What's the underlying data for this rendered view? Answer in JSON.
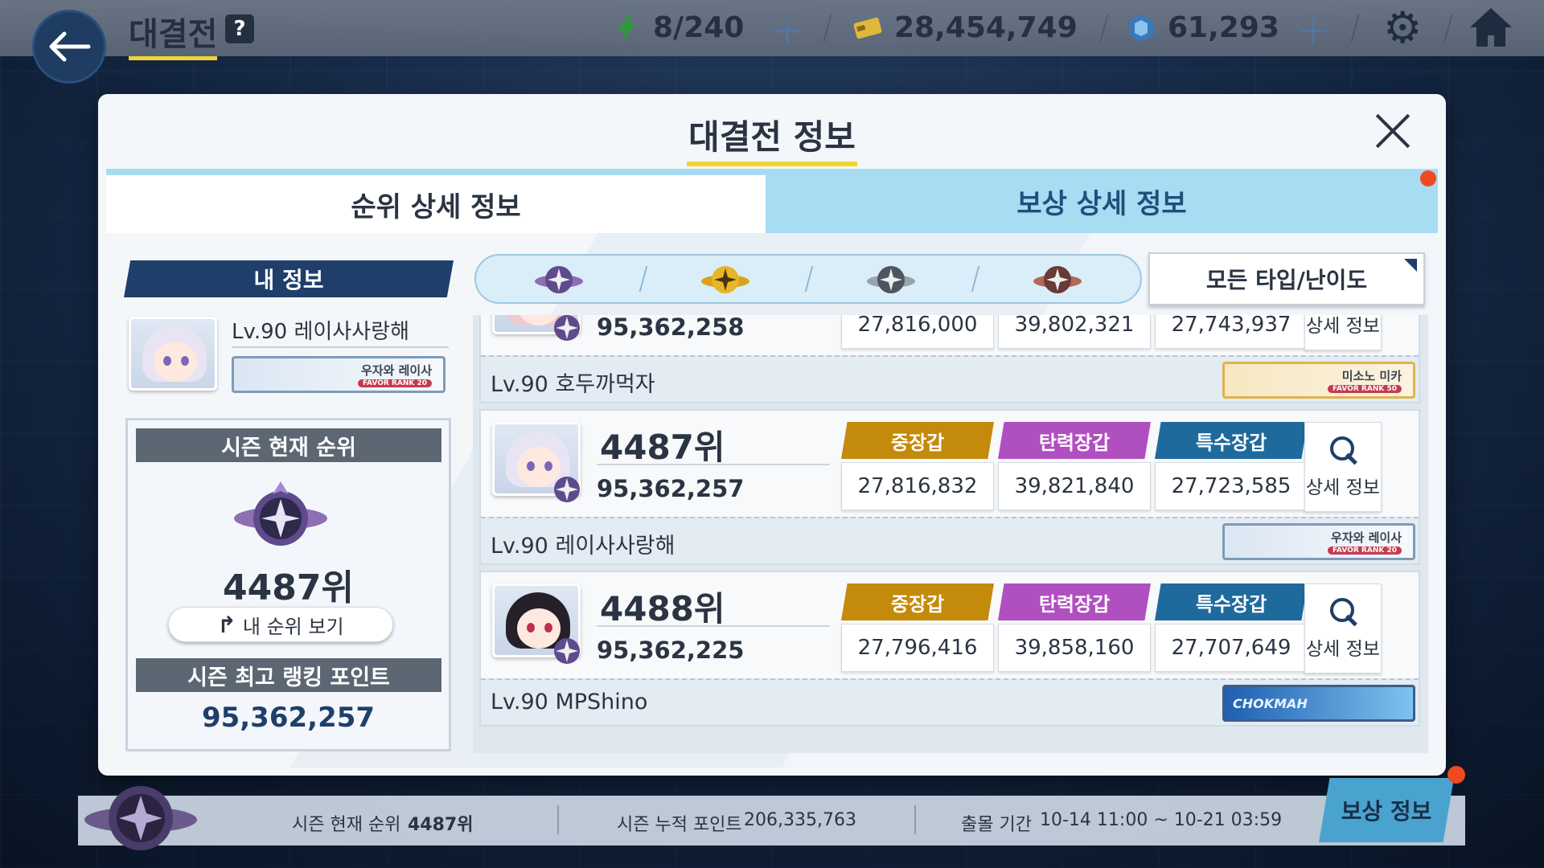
{
  "topbar": {
    "title": "대결전",
    "help_icon": "?",
    "stamina": "8/240",
    "credits": "28,454,749",
    "gems": "61,293"
  },
  "modal": {
    "title": "대결전 정보",
    "tabs": [
      {
        "label": "순위 상세 정보",
        "active": true
      },
      {
        "label": "보상 상세 정보",
        "active": false
      }
    ]
  },
  "my_info": {
    "header": "내 정보",
    "name": "Lv.90 레이사사랑해",
    "card_name": "우자와 레이사",
    "card_rank": "FAVOR RANK 20",
    "season_rank_header": "시즌 현재 순위",
    "rank": "4487위",
    "my_rank_button": "내 순위 보기",
    "best_points_header": "시즌 최고 랭킹 포인트",
    "best_points": "95,362,257"
  },
  "filter": {
    "icons": [
      "platinum-emblem",
      "gold-emblem",
      "silver-emblem",
      "bronze-emblem"
    ],
    "dropdown": "모든 타입/난이도"
  },
  "armor_labels": [
    "중장갑",
    "탄력장갑",
    "특수장갑"
  ],
  "detail_label": "상세 정보",
  "entries": [
    {
      "rank": "",
      "points": "95,362,258",
      "stats": [
        "27,816,000",
        "39,802,321",
        "27,743,937"
      ],
      "name": "Lv.90 호두까먹자",
      "card_name": "미소노 미카",
      "card_rank": "FAVOR RANK 50"
    },
    {
      "rank": "4487위",
      "points": "95,362,257",
      "stats": [
        "27,816,832",
        "39,821,840",
        "27,723,585"
      ],
      "name": "Lv.90 레이사사랑해",
      "card_name": "우자와 레이사",
      "card_rank": "FAVOR RANK 20"
    },
    {
      "rank": "4488위",
      "points": "95,362,225",
      "stats": [
        "27,796,416",
        "39,858,160",
        "27,707,649"
      ],
      "name": "Lv.90 MPShino",
      "card_name": "CHOKMAH",
      "card_rank": ""
    }
  ],
  "bottom": {
    "current_rank_label": "시즌 현재 순위",
    "current_rank": "4487위",
    "total_points_label": "시즌 누적 포인트",
    "total_points": "206,335,763",
    "period_label": "출몰 기간",
    "period": "10-14 11:00 ~ 10-21 03:59",
    "reward_button": "보상 정보"
  },
  "colors": {
    "heavy": "#c48a0c",
    "elastic": "#b04fc0",
    "special": "#1f6a9c",
    "accent_yellow": "#f3d530",
    "notification": "#ef4a22"
  }
}
